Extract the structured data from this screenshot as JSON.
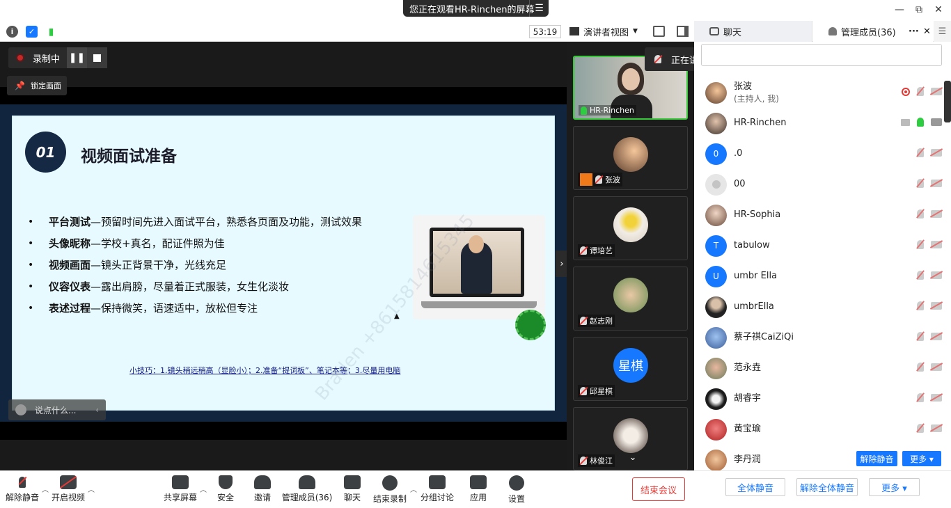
{
  "titlebar": {
    "share_banner": "您正在观看HR-Rinchen的屏幕",
    "minimize": "—",
    "restore": "⧉",
    "close": "✕"
  },
  "toolbar": {
    "timer": "53:19",
    "view_mode": "演讲者视图"
  },
  "panel_tabs": {
    "chat": "聊天",
    "members": "管理成员(36)",
    "more": "···",
    "close": "✕"
  },
  "recording": {
    "status": "录制中"
  },
  "lock_screen": "锁定画面",
  "slide": {
    "badge": "01",
    "title": "视频面试准备",
    "items": [
      {
        "key": "平台测试",
        "text": "—预留时间先进入面试平台，熟悉各页面及功能，测试效果"
      },
      {
        "key": "头像昵称",
        "text": "—学校+真名，配证件照为佳"
      },
      {
        "key": "视频画面",
        "text": "—镜头正背景干净，光线充足"
      },
      {
        "key": "仪容仪表",
        "text": "—露出肩膀，尽量着正式服装，女生化淡妆"
      },
      {
        "key": "表述过程",
        "text": "—保持微笑，语速适中，放松但专注"
      }
    ],
    "tip": "小技巧：1.镜头稍远稍高（显脸小）；2.准备“提词板”、笔记本等；3.尽量用电脑",
    "watermark": "Braden  +8615814615345"
  },
  "say_box": "说点什么...",
  "speaking_tip": "正在讲话: HR-Rinchen;",
  "thumbnails": [
    {
      "name": "HR-Rinchen",
      "muted": false,
      "active": true
    },
    {
      "name": "张波",
      "muted": true,
      "active": false
    },
    {
      "name": "谭培艺",
      "muted": true,
      "active": false
    },
    {
      "name": "赵志刚",
      "muted": true,
      "active": false
    },
    {
      "name": "邱星棋",
      "muted": true,
      "active": false,
      "avatar_text": "星棋"
    },
    {
      "name": "林俊江",
      "muted": true,
      "active": false
    }
  ],
  "members": [
    {
      "name": "张波",
      "sub": "(主持人, 我)",
      "avatar_color": "#8a5a3c"
    },
    {
      "name": "HR-Rinchen",
      "sub": "",
      "avatar_color": "#5c6b4e"
    },
    {
      "name": ".0",
      "sub": "",
      "avatar_color": "#1677ff",
      "avatar_text": "0"
    },
    {
      "name": "00",
      "sub": "",
      "avatar_color": "#e6e6e6"
    },
    {
      "name": "HR-Sophia",
      "sub": "",
      "avatar_color": "#b89a88"
    },
    {
      "name": "tabulow",
      "sub": "",
      "avatar_color": "#1677ff",
      "avatar_text": "T"
    },
    {
      "name": "umbr Ella",
      "sub": "",
      "avatar_color": "#1677ff",
      "avatar_text": "U"
    },
    {
      "name": "umbrElla",
      "sub": "",
      "avatar_color": "#333333"
    },
    {
      "name": "蔡子祺CaiZiQi",
      "sub": "",
      "avatar_color": "#5b86c4"
    },
    {
      "name": "范永垚",
      "sub": "",
      "avatar_color": "#8c6f5a"
    },
    {
      "name": "胡睿宇",
      "sub": "",
      "avatar_color": "#2a2a2a"
    },
    {
      "name": "黄宝瑜",
      "sub": "",
      "avatar_color": "#c0392b"
    },
    {
      "name": "李丹润",
      "sub": "",
      "avatar_color": "#b07050"
    }
  ],
  "member_hover": {
    "unmute": "解除静音",
    "more": "更多 ▾"
  },
  "panel_footer": {
    "mute_all": "全体静音",
    "unmute_all": "解除全体静音",
    "more": "更多 ▾"
  },
  "bottombar": {
    "unmute": "解除静音",
    "start_video": "开启视频",
    "share_screen": "共享屏幕",
    "security": "安全",
    "invite": "邀请",
    "manage_members": "管理成员(36)",
    "chat": "聊天",
    "end_recording": "结束录制",
    "breakout": "分组讨论",
    "apps": "应用",
    "settings": "设置",
    "end_meeting": "结束会议"
  },
  "colors": {
    "accent": "#1677ff",
    "danger": "#e53935",
    "slide_bg": "#e6faff",
    "slide_frame": "#12253f"
  }
}
